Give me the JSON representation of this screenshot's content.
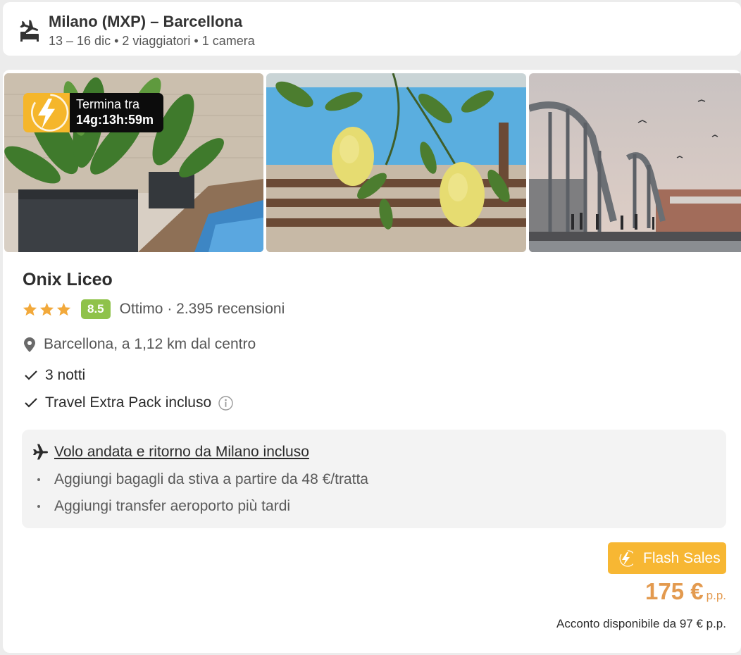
{
  "search": {
    "route": "Milano (MXP) – Barcellona",
    "details": "13 – 16 dic • 2 viaggiatori • 1 camera"
  },
  "deal": {
    "countdown_label": "Termina tra",
    "countdown_value": "14g:13h:59m"
  },
  "hotel": {
    "name": "Onix Liceo",
    "stars": 3,
    "score": "8.5",
    "rating_text": "Ottimo · 2.395 recensioni",
    "location": "Barcellona, a 1,12 km dal centro",
    "features": [
      "3 notti",
      "Travel Extra Pack incluso"
    ]
  },
  "flight": {
    "title": "Volo andata e ritorno da Milano incluso",
    "options": [
      "Aggiungi bagagli da stiva a partire da 48 €/tratta",
      "Aggiungi transfer aeroporto più tardi"
    ]
  },
  "pricing": {
    "badge": "Flash Sales",
    "price": "175 €",
    "unit": "p.p.",
    "deposit": "Acconto disponibile da 97 € p.p."
  },
  "colors": {
    "accent": "#f7b733",
    "price": "#e39a4f",
    "score": "#8fc24a"
  }
}
